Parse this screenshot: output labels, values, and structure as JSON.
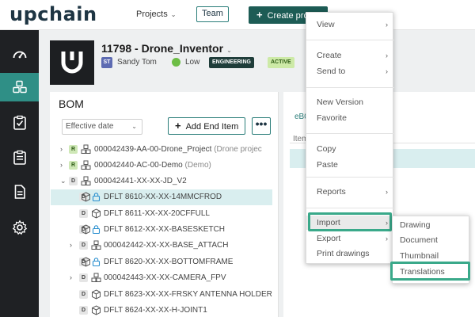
{
  "header": {
    "logo": "upchain",
    "nav_projects": "Projects",
    "nav_team": "Team",
    "create_project": "Create project"
  },
  "sidebar": {
    "items": [
      {
        "icon": "dashboard-icon"
      },
      {
        "icon": "bom-cubes-icon",
        "active": true
      },
      {
        "icon": "tasks-checklist-icon"
      },
      {
        "icon": "clipboard-list-icon"
      },
      {
        "icon": "document-icon"
      },
      {
        "icon": "settings-gear-icon"
      }
    ]
  },
  "project": {
    "title": "11798 - Drone_Inventor",
    "user_initials": "ST",
    "user_name": "Sandy Tom",
    "priority": "Low",
    "tag_type": "ENGINEERING",
    "tag_status": "ACTIVE"
  },
  "bom": {
    "title": "BOM",
    "effective_select": "Effective date",
    "add_end_item": "Add End Item",
    "more": "•••",
    "rows": [
      {
        "chevron": "›",
        "badge": "R",
        "icon": "assembly",
        "lock": false,
        "text": "000042439-AA-00-Drone_Project",
        "muted": "(Drone projec"
      },
      {
        "chevron": "›",
        "badge": "R",
        "icon": "assembly-alt",
        "lock": false,
        "text": "000042440-AC-00-Demo",
        "muted": "(Demo)"
      },
      {
        "chevron": "⌄",
        "badge": "D",
        "icon": "assembly",
        "lock": false,
        "text": "000042441-XX-XX-JD_V2",
        "muted": ""
      },
      {
        "chevron": "",
        "badge": "D",
        "icon": "part",
        "lock": true,
        "text": "DFLT 8610-XX-XX-14MMCFROD",
        "muted": "",
        "selected": true
      },
      {
        "chevron": "",
        "badge": "D",
        "icon": "part",
        "lock": false,
        "text": "DFLT 8611-XX-XX-20CFFULL",
        "muted": ""
      },
      {
        "chevron": "",
        "badge": "D",
        "icon": "part",
        "lock": true,
        "text": "DFLT 8612-XX-XX-BASESKETCH",
        "muted": ""
      },
      {
        "chevron": "›",
        "badge": "D",
        "icon": "assembly",
        "lock": false,
        "text": "000042442-XX-XX-BASE_ATTACH",
        "muted": ""
      },
      {
        "chevron": "",
        "badge": "D",
        "icon": "part",
        "lock": true,
        "text": "DFLT 8620-XX-XX-BOTTOMFRAME",
        "muted": ""
      },
      {
        "chevron": "›",
        "badge": "D",
        "icon": "assembly",
        "lock": false,
        "text": "000042443-XX-XX-CAMERA_FPV",
        "muted": ""
      },
      {
        "chevron": "",
        "badge": "D",
        "icon": "part",
        "lock": false,
        "text": "DFLT 8623-XX-XX-FRSKY ANTENNA HOLDER",
        "muted": ""
      },
      {
        "chevron": "",
        "badge": "D",
        "icon": "part",
        "lock": false,
        "text": "DFLT 8624-XX-XX-H-JOINT1",
        "muted": ""
      }
    ]
  },
  "right_panel": {
    "tab": "eB0",
    "column": "Item"
  },
  "context_menu": {
    "items": [
      {
        "label": "View",
        "arrow": true
      },
      {
        "label": "Create",
        "arrow": true
      },
      {
        "label": "Send to",
        "arrow": true
      },
      {
        "label": "New Version",
        "arrow": false
      },
      {
        "label": "Favorite",
        "arrow": false
      },
      {
        "label": "Copy",
        "arrow": false
      },
      {
        "label": "Paste",
        "arrow": false
      },
      {
        "label": "Reports",
        "arrow": true
      },
      {
        "label": "Import",
        "arrow": true,
        "highlighted": true
      },
      {
        "label": "Export",
        "arrow": true
      },
      {
        "label": "Print drawings",
        "arrow": false
      }
    ],
    "arrow_glyph": "›"
  },
  "import_submenu": {
    "items": [
      {
        "label": "Drawing"
      },
      {
        "label": "Document"
      },
      {
        "label": "Thumbnail"
      },
      {
        "label": "Translations",
        "highlighted": true
      }
    ]
  },
  "colors": {
    "accent_teal": "#2f8f86",
    "highlight_green": "#3aa98a",
    "sidebar_dark": "#1f2124",
    "create_button": "#1d5c55"
  }
}
